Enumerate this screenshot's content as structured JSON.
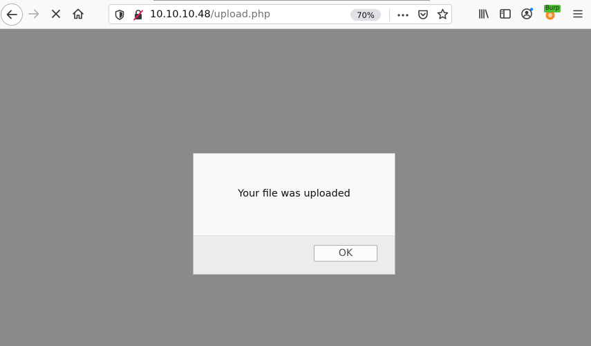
{
  "browser": {
    "url_host": "10.10.10.48",
    "url_path": "/upload.php",
    "zoom_level": "70%",
    "burp_badge": "Burp",
    "icons": {
      "back": "back-arrow-icon",
      "forward": "forward-arrow-icon",
      "stop": "stop-icon",
      "home": "home-icon",
      "tracking_protection": "shield-icon",
      "insecure_connection": "insecure-lock-icon",
      "page_actions": "more-icon",
      "pocket": "pocket-icon",
      "bookmark": "star-icon",
      "library": "library-icon",
      "sidebar": "sidebar-icon",
      "account": "account-icon",
      "burp_extension": "burp-extension-icon",
      "menu": "hamburger-menu-icon"
    }
  },
  "dialog": {
    "message": "Your file was uploaded",
    "ok_label": "OK"
  },
  "colors": {
    "overlay": "#8a8a8a",
    "toolbar": "#f9f9fa",
    "dialog_body": "#f9f9fa",
    "dialog_footer": "#ececec",
    "burp_badge": "#4fbe34"
  }
}
